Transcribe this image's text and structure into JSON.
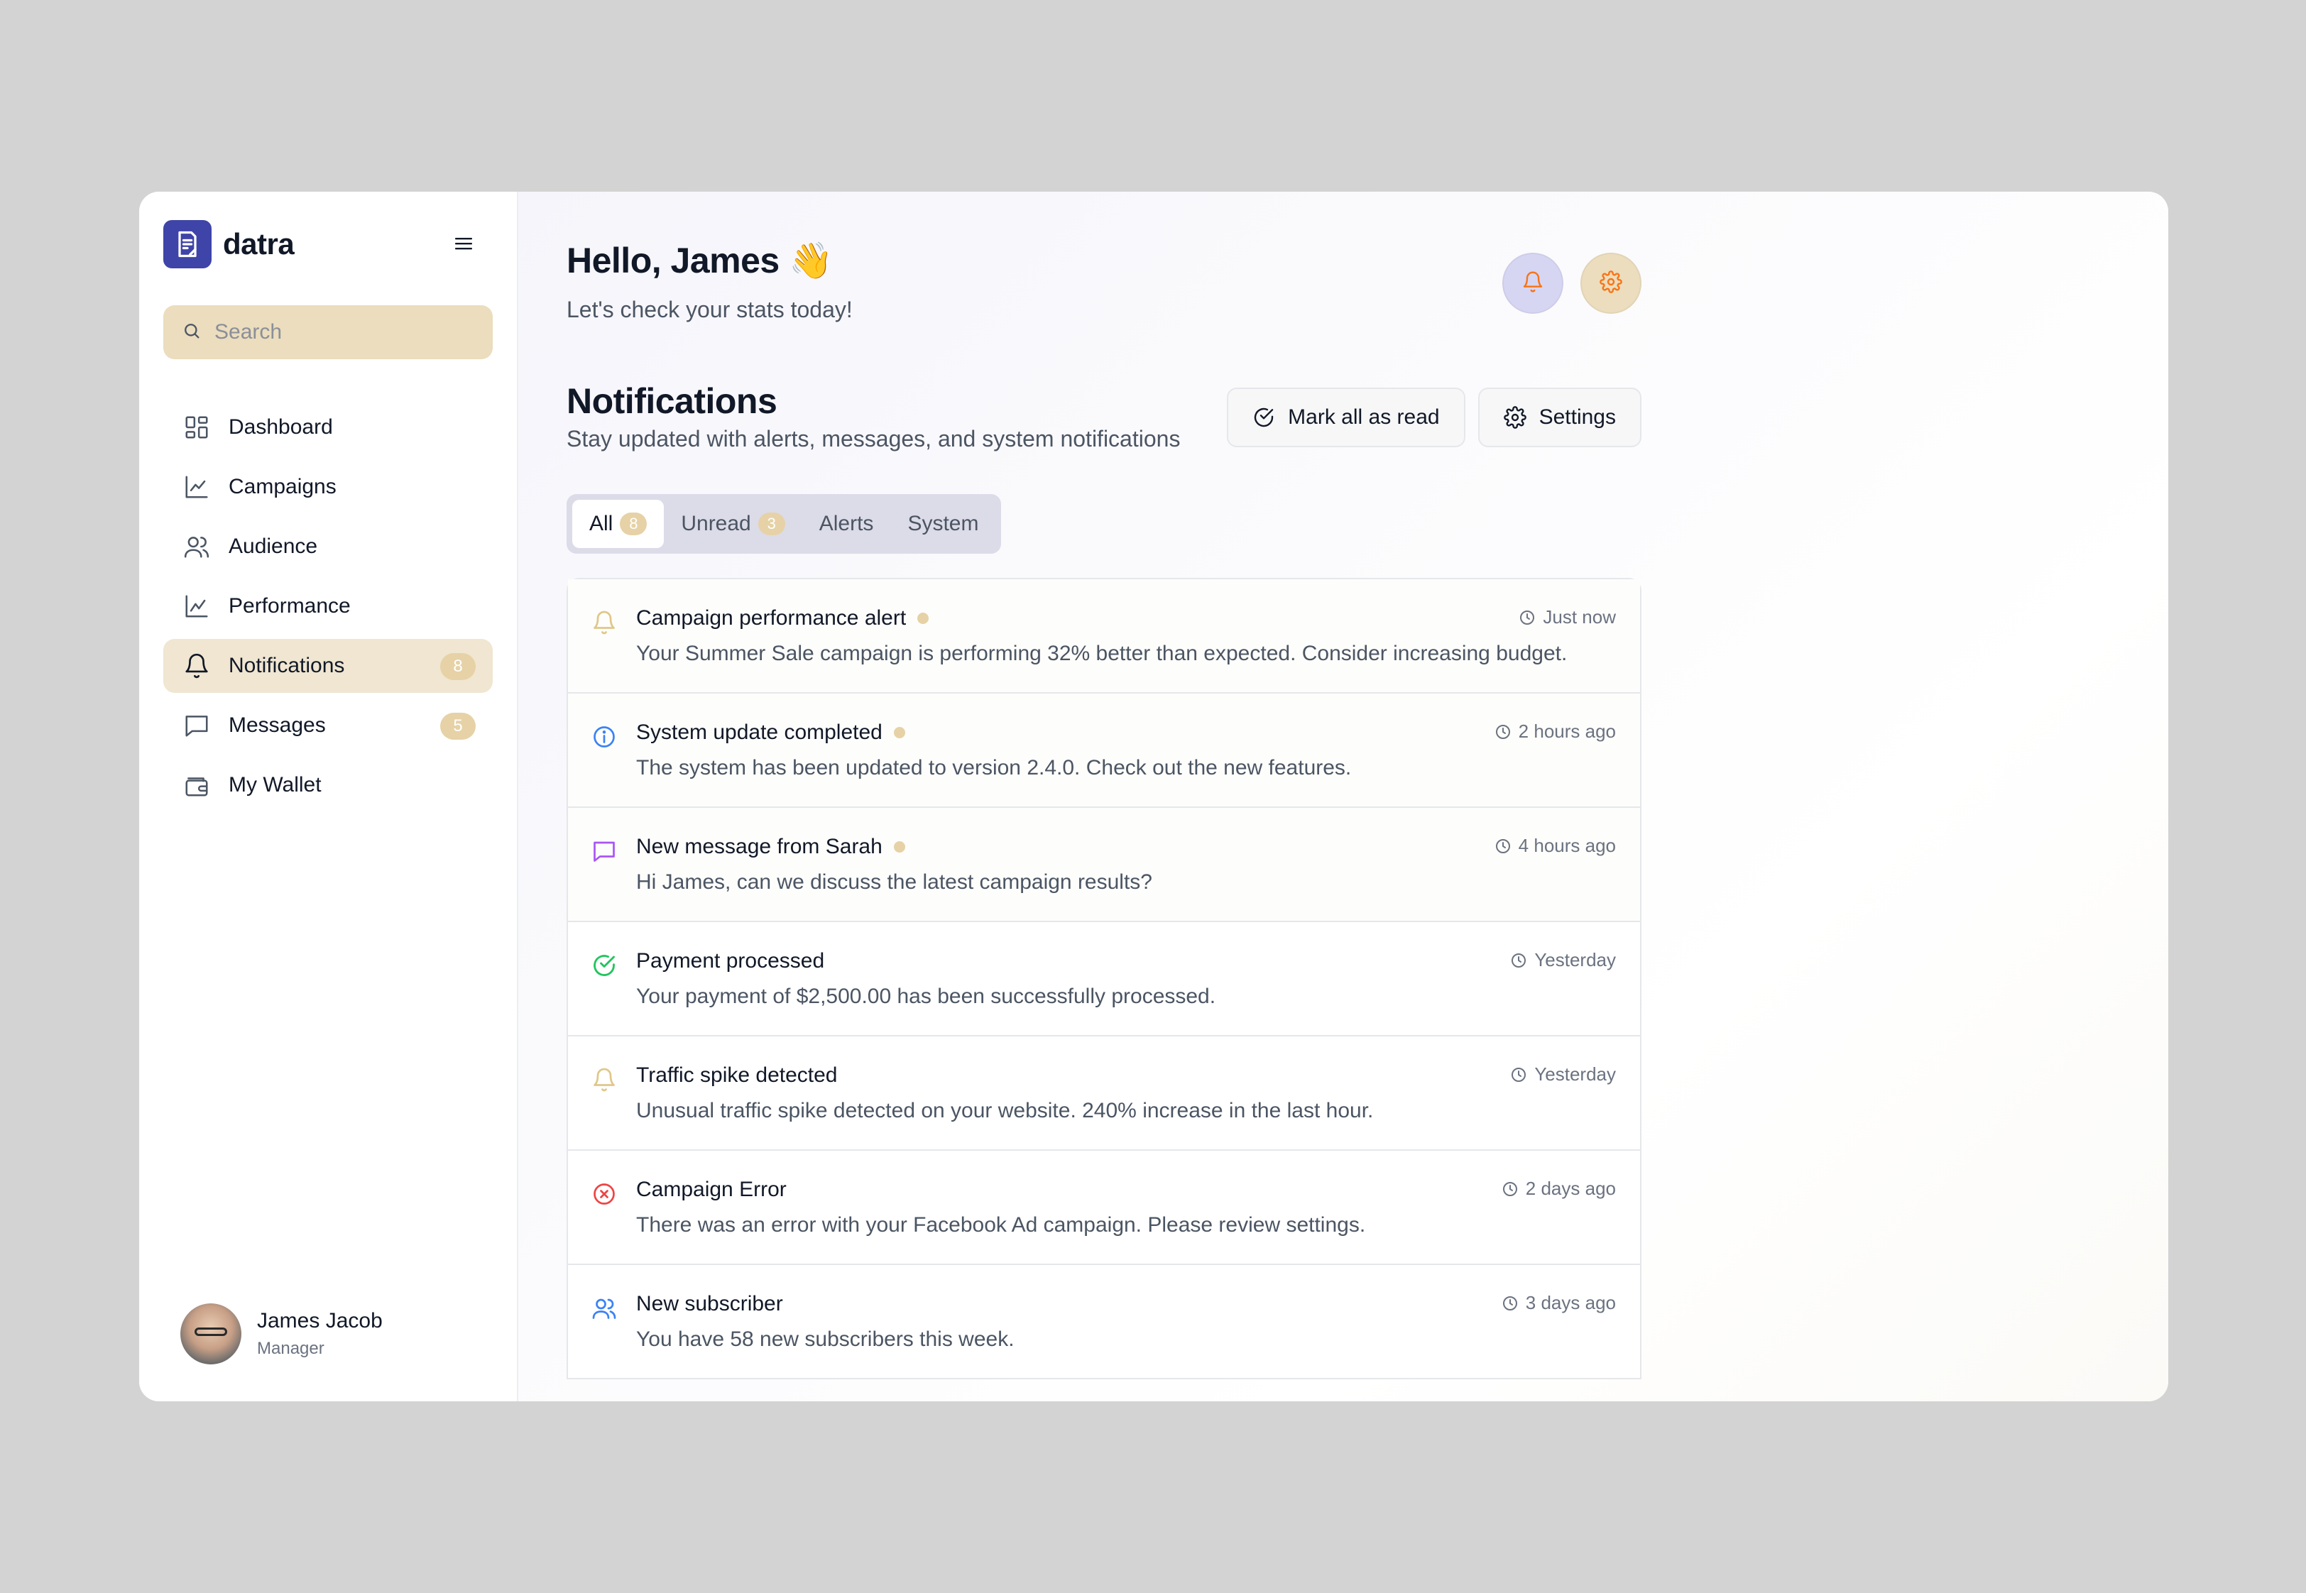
{
  "brand": {
    "name": "datra"
  },
  "search": {
    "placeholder": "Search"
  },
  "sidebar": {
    "items": [
      {
        "label": "Dashboard",
        "icon": "grid-icon",
        "badge": null
      },
      {
        "label": "Campaigns",
        "icon": "chart-line-icon",
        "badge": null
      },
      {
        "label": "Audience",
        "icon": "users-icon",
        "badge": null
      },
      {
        "label": "Performance",
        "icon": "chart-line-icon",
        "badge": null
      },
      {
        "label": "Notifications",
        "icon": "bell-icon",
        "badge": "8",
        "active": true
      },
      {
        "label": "Messages",
        "icon": "message-icon",
        "badge": "5"
      },
      {
        "label": "My Wallet",
        "icon": "wallet-icon",
        "badge": null
      }
    ]
  },
  "user": {
    "name": "James Jacob",
    "role": "Manager"
  },
  "header": {
    "greeting": "Hello, James 👋",
    "subtitle": "Let's check your stats today!"
  },
  "notifications": {
    "title": "Notifications",
    "subtitle": "Stay updated with alerts, messages, and system notifications",
    "mark_all_label": "Mark all as read",
    "settings_label": "Settings",
    "tabs": [
      {
        "label": "All",
        "badge": "8",
        "active": true
      },
      {
        "label": "Unread",
        "badge": "3"
      },
      {
        "label": "Alerts"
      },
      {
        "label": "System"
      }
    ],
    "items": [
      {
        "title": "Campaign performance alert",
        "body": "Your Summer Sale campaign is performing 32% better than expected. Consider increasing budget.",
        "time": "Just now",
        "icon": "bell-icon",
        "unread": true
      },
      {
        "title": "System update completed",
        "body": "The system has been updated to version 2.4.0. Check out the new features.",
        "time": "2 hours ago",
        "icon": "info-icon",
        "unread": true
      },
      {
        "title": "New message from Sarah",
        "body": "Hi James, can we discuss the latest campaign results?",
        "time": "4 hours ago",
        "icon": "message-icon",
        "unread": true
      },
      {
        "title": "Payment processed",
        "body": "Your payment of $2,500.00 has been successfully processed.",
        "time": "Yesterday",
        "icon": "check-circle-icon",
        "unread": false
      },
      {
        "title": "Traffic spike detected",
        "body": "Unusual traffic spike detected on your website. 240% increase in the last hour.",
        "time": "Yesterday",
        "icon": "bell-icon",
        "unread": false
      },
      {
        "title": "Campaign Error",
        "body": "There was an error with your Facebook Ad campaign. Please review settings.",
        "time": "2 days ago",
        "icon": "x-circle-icon",
        "unread": false
      },
      {
        "title": "New subscriber",
        "body": "You have 58 new subscribers this week.",
        "time": "3 days ago",
        "icon": "users-icon",
        "unread": false
      }
    ]
  },
  "colors": {
    "brand": "#3f44a8",
    "accent_sand": "#ebddbd",
    "badge": "#e6d2a6",
    "alert_bell": "#e0c78a",
    "info": "#3b82f6",
    "message": "#a855f7",
    "success": "#22c55e",
    "error": "#ef4444",
    "users": "#3b82f6"
  }
}
